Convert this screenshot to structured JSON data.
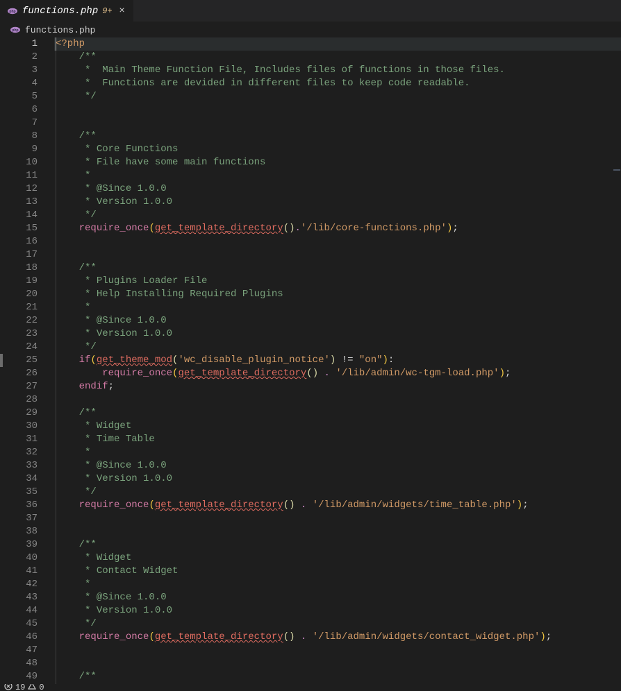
{
  "tab": {
    "title": "functions.php",
    "dirty_marker": "9+",
    "close_glyph": "×"
  },
  "breadcrumb": {
    "file": "functions.php"
  },
  "icons": {
    "php": "#b084c7"
  },
  "lines": {
    "start": 1,
    "end": 49
  },
  "code": [
    {
      "n": 1,
      "seg": [
        {
          "t": "<?php",
          "c": "tk-php"
        }
      ],
      "hl": true
    },
    {
      "n": 2,
      "seg": [
        {
          "t": "    ",
          "c": ""
        },
        {
          "t": "/**",
          "c": "tk-comment"
        }
      ]
    },
    {
      "n": 3,
      "seg": [
        {
          "t": "    ",
          "c": ""
        },
        {
          "t": " *  Main Theme Function File, Includes files of functions in those files.",
          "c": "tk-comment"
        }
      ]
    },
    {
      "n": 4,
      "seg": [
        {
          "t": "    ",
          "c": ""
        },
        {
          "t": " *  Functions are devided in different files to keep code readable.",
          "c": "tk-comment"
        }
      ]
    },
    {
      "n": 5,
      "seg": [
        {
          "t": "    ",
          "c": ""
        },
        {
          "t": " */",
          "c": "tk-comment"
        }
      ]
    },
    {
      "n": 6,
      "seg": []
    },
    {
      "n": 7,
      "seg": []
    },
    {
      "n": 8,
      "seg": [
        {
          "t": "    ",
          "c": ""
        },
        {
          "t": "/**",
          "c": "tk-comment"
        }
      ]
    },
    {
      "n": 9,
      "seg": [
        {
          "t": "    ",
          "c": ""
        },
        {
          "t": " * Core Functions",
          "c": "tk-comment"
        }
      ]
    },
    {
      "n": 10,
      "seg": [
        {
          "t": "    ",
          "c": ""
        },
        {
          "t": " * File have some main functions",
          "c": "tk-comment"
        }
      ]
    },
    {
      "n": 11,
      "seg": [
        {
          "t": "    ",
          "c": ""
        },
        {
          "t": " *",
          "c": "tk-comment"
        }
      ]
    },
    {
      "n": 12,
      "seg": [
        {
          "t": "    ",
          "c": ""
        },
        {
          "t": " * @Since 1.0.0",
          "c": "tk-comment"
        }
      ]
    },
    {
      "n": 13,
      "seg": [
        {
          "t": "    ",
          "c": ""
        },
        {
          "t": " * Version 1.0.0",
          "c": "tk-comment"
        }
      ]
    },
    {
      "n": 14,
      "seg": [
        {
          "t": "    ",
          "c": ""
        },
        {
          "t": " */",
          "c": "tk-comment"
        }
      ]
    },
    {
      "n": 15,
      "seg": [
        {
          "t": "    ",
          "c": ""
        },
        {
          "t": "require_once",
          "c": "tk-keyword"
        },
        {
          "t": "(",
          "c": "tk-bracket1"
        },
        {
          "t": "get_template_directory",
          "c": "tk-func"
        },
        {
          "t": "()",
          "c": "tk-paren"
        },
        {
          "t": ".",
          "c": "tk-dot"
        },
        {
          "t": "'/lib/core-functions.php'",
          "c": "tk-str"
        },
        {
          "t": ")",
          "c": "tk-bracket1"
        },
        {
          "t": ";",
          "c": "tk-punc"
        }
      ]
    },
    {
      "n": 16,
      "seg": []
    },
    {
      "n": 17,
      "seg": []
    },
    {
      "n": 18,
      "seg": [
        {
          "t": "    ",
          "c": ""
        },
        {
          "t": "/**",
          "c": "tk-comment"
        }
      ]
    },
    {
      "n": 19,
      "seg": [
        {
          "t": "    ",
          "c": ""
        },
        {
          "t": " * Plugins Loader File",
          "c": "tk-comment"
        }
      ]
    },
    {
      "n": 20,
      "seg": [
        {
          "t": "    ",
          "c": ""
        },
        {
          "t": " * Help Installing Required Plugins",
          "c": "tk-comment"
        }
      ]
    },
    {
      "n": 21,
      "seg": [
        {
          "t": "    ",
          "c": ""
        },
        {
          "t": " *",
          "c": "tk-comment"
        }
      ]
    },
    {
      "n": 22,
      "seg": [
        {
          "t": "    ",
          "c": ""
        },
        {
          "t": " * @Since 1.0.0",
          "c": "tk-comment"
        }
      ]
    },
    {
      "n": 23,
      "seg": [
        {
          "t": "    ",
          "c": ""
        },
        {
          "t": " * Version 1.0.0",
          "c": "tk-comment"
        }
      ]
    },
    {
      "n": 24,
      "seg": [
        {
          "t": "    ",
          "c": ""
        },
        {
          "t": " */",
          "c": "tk-comment"
        }
      ]
    },
    {
      "n": 25,
      "seg": [
        {
          "t": "    ",
          "c": ""
        },
        {
          "t": "if",
          "c": "tk-keyword"
        },
        {
          "t": "(",
          "c": "tk-bracket1"
        },
        {
          "t": "get_theme_mod",
          "c": "tk-func"
        },
        {
          "t": "(",
          "c": "tk-paren"
        },
        {
          "t": "'wc_disable_plugin_notice'",
          "c": "tk-str"
        },
        {
          "t": ")",
          "c": "tk-paren"
        },
        {
          "t": " != ",
          "c": "tk-op"
        },
        {
          "t": "\"on\"",
          "c": "tk-str"
        },
        {
          "t": ")",
          "c": "tk-bracket1"
        },
        {
          "t": ":",
          "c": "tk-punc"
        }
      ]
    },
    {
      "n": 26,
      "seg": [
        {
          "t": "        ",
          "c": ""
        },
        {
          "t": "require_once",
          "c": "tk-keyword"
        },
        {
          "t": "(",
          "c": "tk-bracket1"
        },
        {
          "t": "get_template_directory",
          "c": "tk-func"
        },
        {
          "t": "()",
          "c": "tk-paren"
        },
        {
          "t": " . ",
          "c": "tk-dot"
        },
        {
          "t": "'/lib/admin/wc-tgm-load.php'",
          "c": "tk-str"
        },
        {
          "t": ")",
          "c": "tk-bracket1"
        },
        {
          "t": ";",
          "c": "tk-punc"
        }
      ]
    },
    {
      "n": 27,
      "seg": [
        {
          "t": "    ",
          "c": ""
        },
        {
          "t": "endif",
          "c": "tk-keyword"
        },
        {
          "t": ";",
          "c": "tk-punc"
        }
      ]
    },
    {
      "n": 28,
      "seg": []
    },
    {
      "n": 29,
      "seg": [
        {
          "t": "    ",
          "c": ""
        },
        {
          "t": "/**",
          "c": "tk-comment"
        }
      ]
    },
    {
      "n": 30,
      "seg": [
        {
          "t": "    ",
          "c": ""
        },
        {
          "t": " * Widget",
          "c": "tk-comment"
        }
      ]
    },
    {
      "n": 31,
      "seg": [
        {
          "t": "    ",
          "c": ""
        },
        {
          "t": " * Time Table",
          "c": "tk-comment"
        }
      ]
    },
    {
      "n": 32,
      "seg": [
        {
          "t": "    ",
          "c": ""
        },
        {
          "t": " *",
          "c": "tk-comment"
        }
      ]
    },
    {
      "n": 33,
      "seg": [
        {
          "t": "    ",
          "c": ""
        },
        {
          "t": " * @Since 1.0.0",
          "c": "tk-comment"
        }
      ]
    },
    {
      "n": 34,
      "seg": [
        {
          "t": "    ",
          "c": ""
        },
        {
          "t": " * Version 1.0.0",
          "c": "tk-comment"
        }
      ]
    },
    {
      "n": 35,
      "seg": [
        {
          "t": "    ",
          "c": ""
        },
        {
          "t": " */",
          "c": "tk-comment"
        }
      ]
    },
    {
      "n": 36,
      "seg": [
        {
          "t": "    ",
          "c": ""
        },
        {
          "t": "require_once",
          "c": "tk-keyword"
        },
        {
          "t": "(",
          "c": "tk-bracket1"
        },
        {
          "t": "get_template_directory",
          "c": "tk-func"
        },
        {
          "t": "()",
          "c": "tk-paren"
        },
        {
          "t": " . ",
          "c": "tk-dot"
        },
        {
          "t": "'/lib/admin/widgets/time_table.php'",
          "c": "tk-str"
        },
        {
          "t": ")",
          "c": "tk-bracket1"
        },
        {
          "t": ";",
          "c": "tk-punc"
        }
      ]
    },
    {
      "n": 37,
      "seg": []
    },
    {
      "n": 38,
      "seg": []
    },
    {
      "n": 39,
      "seg": [
        {
          "t": "    ",
          "c": ""
        },
        {
          "t": "/**",
          "c": "tk-comment"
        }
      ]
    },
    {
      "n": 40,
      "seg": [
        {
          "t": "    ",
          "c": ""
        },
        {
          "t": " * Widget",
          "c": "tk-comment"
        }
      ]
    },
    {
      "n": 41,
      "seg": [
        {
          "t": "    ",
          "c": ""
        },
        {
          "t": " * Contact Widget",
          "c": "tk-comment"
        }
      ]
    },
    {
      "n": 42,
      "seg": [
        {
          "t": "    ",
          "c": ""
        },
        {
          "t": " *",
          "c": "tk-comment"
        }
      ]
    },
    {
      "n": 43,
      "seg": [
        {
          "t": "    ",
          "c": ""
        },
        {
          "t": " * @Since 1.0.0",
          "c": "tk-comment"
        }
      ]
    },
    {
      "n": 44,
      "seg": [
        {
          "t": "    ",
          "c": ""
        },
        {
          "t": " * Version 1.0.0",
          "c": "tk-comment"
        }
      ]
    },
    {
      "n": 45,
      "seg": [
        {
          "t": "    ",
          "c": ""
        },
        {
          "t": " */",
          "c": "tk-comment"
        }
      ]
    },
    {
      "n": 46,
      "seg": [
        {
          "t": "    ",
          "c": ""
        },
        {
          "t": "require_once",
          "c": "tk-keyword"
        },
        {
          "t": "(",
          "c": "tk-bracket1"
        },
        {
          "t": "get_template_directory",
          "c": "tk-func"
        },
        {
          "t": "()",
          "c": "tk-paren"
        },
        {
          "t": " . ",
          "c": "tk-dot"
        },
        {
          "t": "'/lib/admin/widgets/contact_widget.php'",
          "c": "tk-str"
        },
        {
          "t": ")",
          "c": "tk-bracket1"
        },
        {
          "t": ";",
          "c": "tk-punc"
        }
      ]
    },
    {
      "n": 47,
      "seg": []
    },
    {
      "n": 48,
      "seg": []
    },
    {
      "n": 49,
      "seg": [
        {
          "t": "    ",
          "c": ""
        },
        {
          "t": "/**",
          "c": "tk-comment"
        }
      ]
    }
  ],
  "status": {
    "errors": "19",
    "warnings": "0"
  }
}
